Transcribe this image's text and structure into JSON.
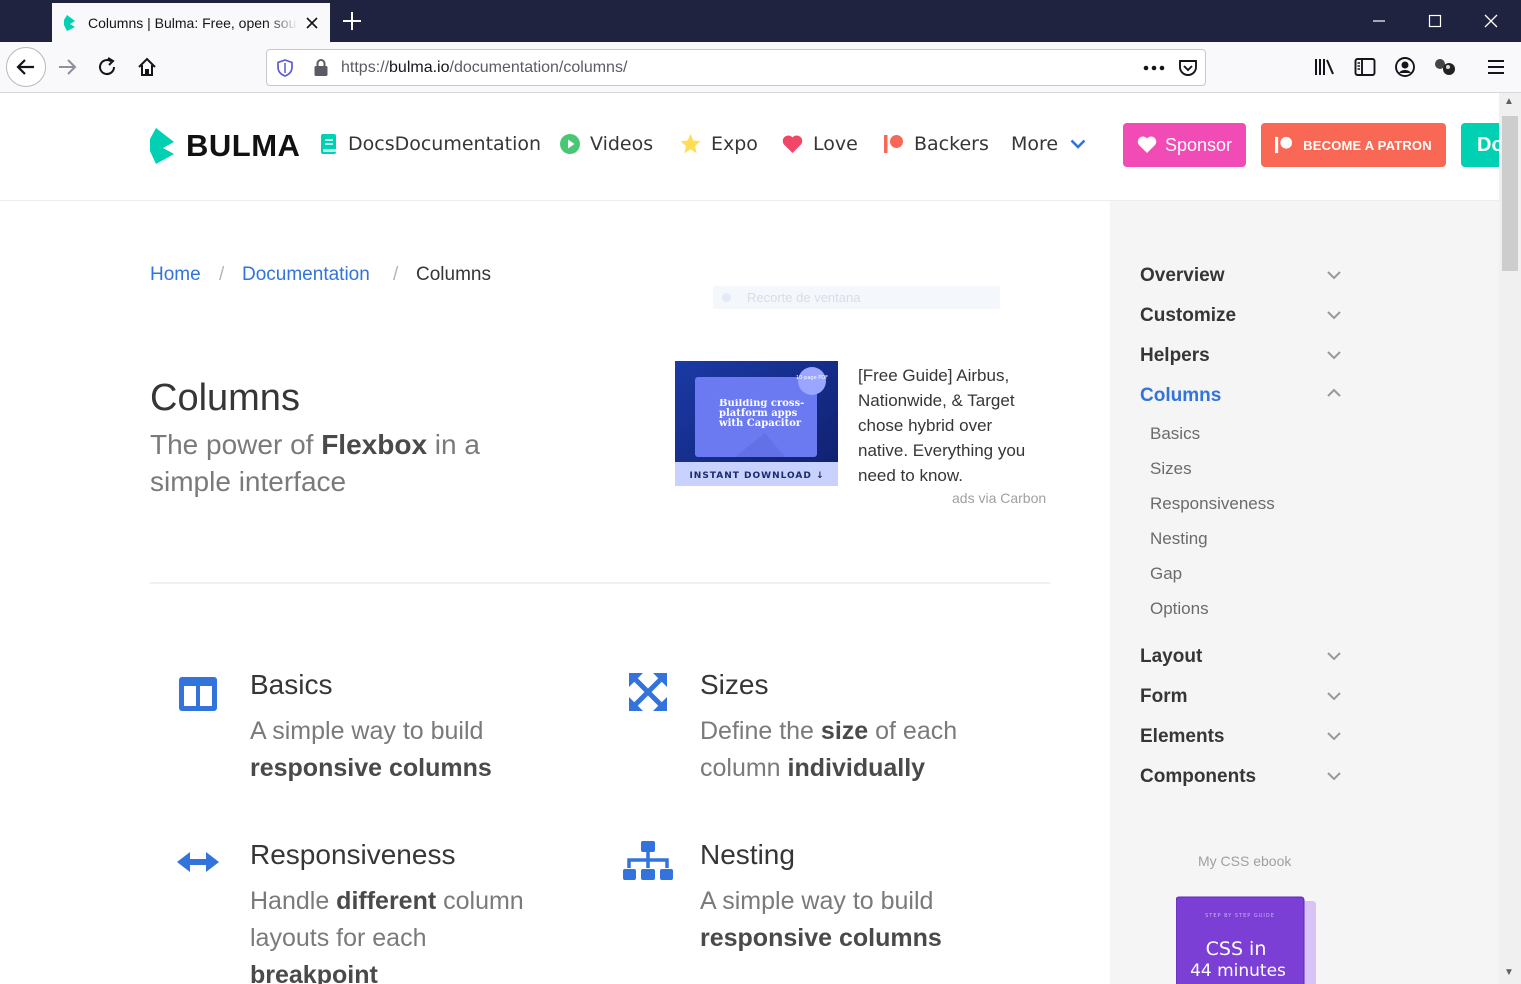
{
  "browser": {
    "tab_title": "Columns | Bulma: Free, open source",
    "url_prefix": "https://",
    "url_host": "bulma.io",
    "url_path": "/documentation/columns/"
  },
  "nav": {
    "logo": "BULMA",
    "items": [
      {
        "label": "DocsDocumentation",
        "icon": "book-icon"
      },
      {
        "label": "Videos",
        "icon": "play-icon"
      },
      {
        "label": "Expo",
        "icon": "star-icon"
      },
      {
        "label": "Love",
        "icon": "heart-icon"
      },
      {
        "label": "Backers",
        "icon": "patreon-icon"
      },
      {
        "label": "More",
        "icon": "chevron-down-icon"
      }
    ],
    "sponsor": "Sponsor",
    "patron": "BECOME A PATRON",
    "download": "Do"
  },
  "breadcrumb": {
    "home": "Home",
    "docs": "Documentation",
    "current": "Columns",
    "sep": "/"
  },
  "ghost_overlay": "Recorte de ventana",
  "hero": {
    "title": "Columns",
    "sub_a": "The power of ",
    "sub_b": "Flexbox",
    "sub_c": " in a simple interface"
  },
  "ad": {
    "text": "[Free Guide] Airbus, Nationwide, & Target chose hybrid over native. Everything you need to know.",
    "via": "ads via Carbon",
    "img_heading": "Building cross-platform apps with Capacitor",
    "img_badge": "10-page PDF",
    "img_cta": "INSTANT DOWNLOAD ↓"
  },
  "features": [
    {
      "title": "Basics",
      "a": "A simple way to build ",
      "b": "responsive columns",
      "c": ""
    },
    {
      "title": "Sizes",
      "a": "Define the ",
      "b": "size",
      "c": " of each column ",
      "d": "individually"
    },
    {
      "title": "Responsiveness",
      "a": "Handle ",
      "b": "different",
      "c": " column layouts for each ",
      "d": "breakpoint"
    },
    {
      "title": "Nesting",
      "a": "A simple way to build ",
      "b": "responsive columns",
      "c": ""
    }
  ],
  "sidebar": {
    "categories": [
      "Overview",
      "Customize",
      "Helpers",
      "Columns",
      "Layout",
      "Form",
      "Elements",
      "Components"
    ],
    "columns_sub": [
      "Basics",
      "Sizes",
      "Responsiveness",
      "Nesting",
      "Gap",
      "Options"
    ],
    "ebook_label": "My CSS ebook",
    "ebook_title_1": "CSS in",
    "ebook_title_2": "44 minutes",
    "ebook_kicker": "STEP BY STEP GUIDE"
  },
  "colors": {
    "primary": "#00d1b2",
    "link": "#3273dc",
    "sponsor": "#f14bb5",
    "patron": "#f96854",
    "text": "#363636"
  }
}
